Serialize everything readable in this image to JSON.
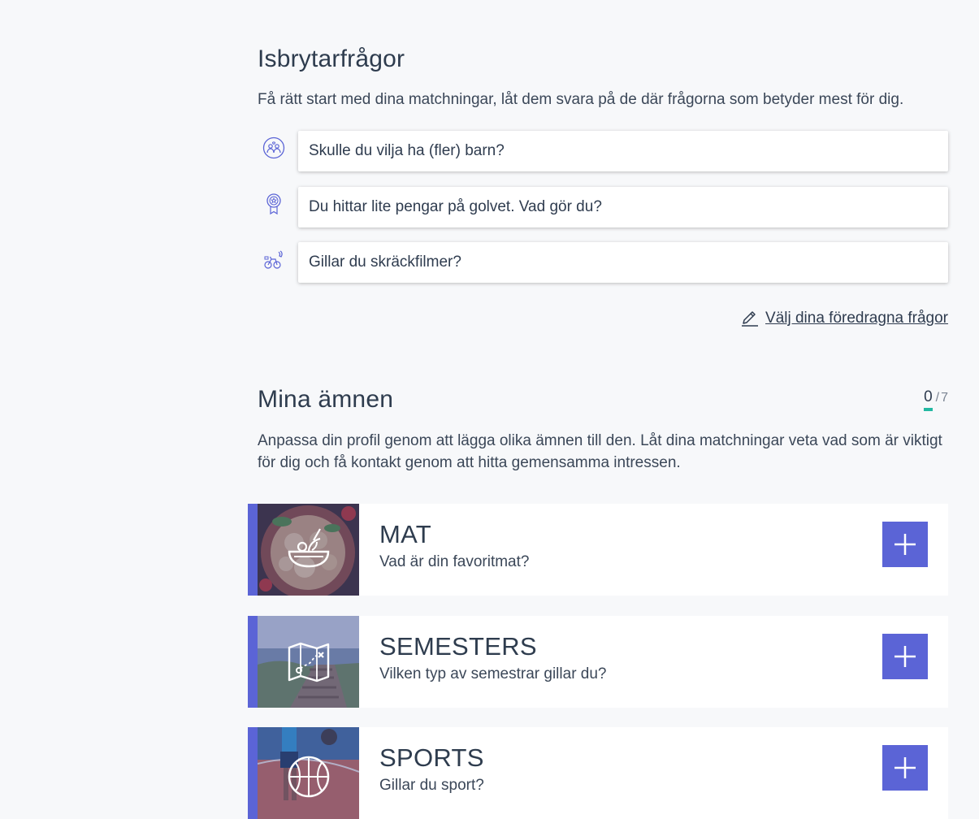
{
  "icebreakers": {
    "title": "Isbrytarfrågor",
    "description": "Få rätt start med dina matchningar, låt dem svara på de där frågorna som betyder mest för dig.",
    "questions": [
      {
        "icon": "family-icon",
        "text": "Skulle du vilja ha (fler) barn?"
      },
      {
        "icon": "medal-icon",
        "text": "Du hittar lite pengar på golvet. Vad gör du?"
      },
      {
        "icon": "hobbies-icon",
        "text": "Gillar du skräckfilmer?"
      }
    ],
    "choose_link": "Välj dina föredragna frågor"
  },
  "topics": {
    "title": "Mina ämnen",
    "counter_current": "0",
    "counter_separator": "/",
    "counter_total": "7",
    "description": "Anpassa din profil genom att lägga olika ämnen till den. Låt dina matchningar veta vad som är viktigt för dig och få kontakt genom att hitta gemensamma intressen.",
    "items": [
      {
        "name": "MAT",
        "subtitle": "Vad är din favoritmat?",
        "icon": "food-bowl-icon"
      },
      {
        "name": "SEMESTERS",
        "subtitle": "Vilken typ av semestrar gillar du?",
        "icon": "treasure-map-icon"
      },
      {
        "name": "SPORTS",
        "subtitle": "Gillar du sport?",
        "icon": "basketball-icon"
      }
    ]
  },
  "colors": {
    "accent": "#5b64d6",
    "counter_underline": "#23b8a2",
    "background": "#f7f8fa"
  }
}
